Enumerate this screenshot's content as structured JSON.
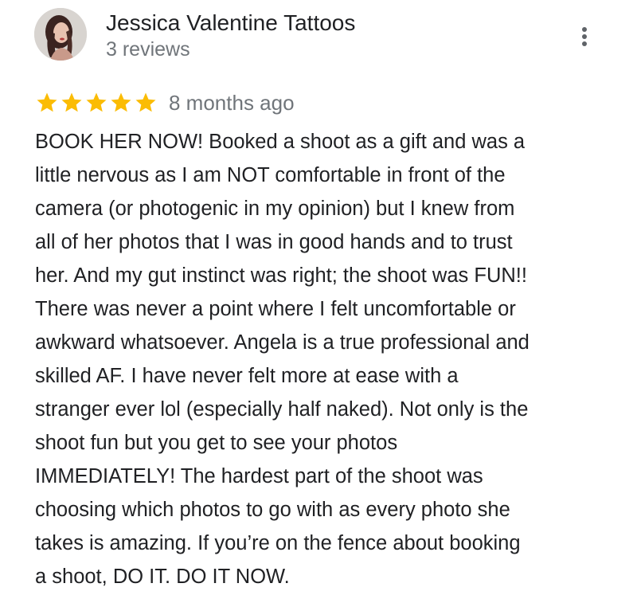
{
  "reviewer": {
    "name": "Jessica Valentine Tattoos",
    "review_count": "3 reviews",
    "avatar_icon": "profile-photo"
  },
  "review": {
    "rating": 5,
    "rating_max": 5,
    "star_color": "#fbbc04",
    "date": "8 months ago",
    "text_lines": [
      "BOOK HER NOW! Booked a shoot as a gift and was a",
      "little nervous as I am NOT comfortable in front of the",
      "camera (or photogenic in my opinion) but I knew from",
      "all of her photos that I was in good hands and to trust",
      "her. And my gut instinct was right; the shoot was FUN!!",
      "There was never a point where I felt uncomfortable or",
      "awkward whatsoever. Angela is a true professional and",
      "skilled AF. I have never felt more at ease with a",
      "stranger ever lol (especially half naked). Not only is the",
      "shoot fun but you get to see your photos",
      "IMMEDIATELY! The hardest part of the shoot was",
      "choosing which photos to go with as every photo she",
      "takes is amazing. If you’re on the fence about booking",
      "a shoot, DO IT. DO IT NOW."
    ]
  },
  "actions": {
    "more_icon": "more-vert-icon"
  }
}
